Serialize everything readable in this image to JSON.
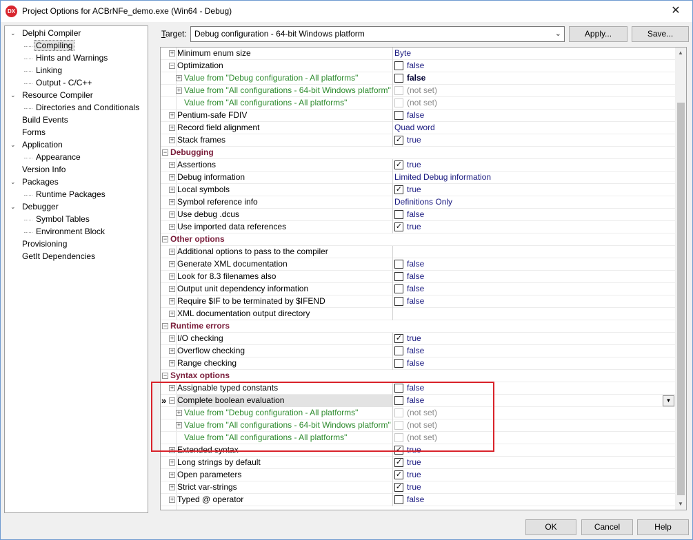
{
  "window": {
    "icon_text": "DX",
    "title": "Project Options for ACBrNFe_demo.exe  (Win64 - Debug)",
    "close_glyph": "✕"
  },
  "tree": [
    {
      "label": "Delphi Compiler",
      "level": 0,
      "expander": "⌄"
    },
    {
      "label": "Compiling",
      "level": 1,
      "selected": true
    },
    {
      "label": "Hints and Warnings",
      "level": 1
    },
    {
      "label": "Linking",
      "level": 1
    },
    {
      "label": "Output - C/C++",
      "level": 1
    },
    {
      "label": "Resource Compiler",
      "level": 0,
      "expander": "⌄"
    },
    {
      "label": "Directories and Conditionals",
      "level": 1
    },
    {
      "label": "Build Events",
      "level": 0
    },
    {
      "label": "Forms",
      "level": 0
    },
    {
      "label": "Application",
      "level": 0,
      "expander": "⌄"
    },
    {
      "label": "Appearance",
      "level": 1
    },
    {
      "label": "Version Info",
      "level": 0
    },
    {
      "label": "Packages",
      "level": 0,
      "expander": "⌄"
    },
    {
      "label": "Runtime Packages",
      "level": 1
    },
    {
      "label": "Debugger",
      "level": 0,
      "expander": "⌄"
    },
    {
      "label": "Symbol Tables",
      "level": 1
    },
    {
      "label": "Environment Block",
      "level": 1
    },
    {
      "label": "Provisioning",
      "level": 0
    },
    {
      "label": "GetIt Dependencies",
      "level": 0
    }
  ],
  "target": {
    "label_prefix": "T",
    "label_rest": "arget:",
    "value": "Debug configuration - 64-bit Windows platform",
    "arrow": "⌄",
    "apply": "Apply...",
    "save": "Save..."
  },
  "grid": [
    {
      "type": "item",
      "name": "Minimum enum size",
      "value": "Byte",
      "exp": "+"
    },
    {
      "type": "item",
      "name": "Optimization",
      "value": "false",
      "check": false,
      "exp": "−"
    },
    {
      "type": "sub",
      "name": "Value from \"Debug configuration - All platforms\"",
      "value": "false",
      "check": false,
      "bold": true,
      "exp": "+"
    },
    {
      "type": "sub",
      "name": "Value from \"All configurations - 64-bit Windows platform\"",
      "value": "(not set)",
      "check": false,
      "notset": true,
      "exp": "+"
    },
    {
      "type": "sub",
      "name": "Value from \"All configurations - All platforms\"",
      "value": "(not set)",
      "check": false,
      "notset": true
    },
    {
      "type": "item",
      "name": "Pentium-safe FDIV",
      "value": "false",
      "check": false,
      "exp": "+"
    },
    {
      "type": "item",
      "name": "Record field alignment",
      "value": "Quad word",
      "exp": "+"
    },
    {
      "type": "item",
      "name": "Stack frames",
      "value": "true",
      "check": true,
      "exp": "+"
    },
    {
      "type": "cat",
      "name": "Debugging"
    },
    {
      "type": "item",
      "name": "Assertions",
      "value": "true",
      "check": true,
      "exp": "+"
    },
    {
      "type": "item",
      "name": "Debug information",
      "value": "Limited Debug information",
      "exp": "+"
    },
    {
      "type": "item",
      "name": "Local symbols",
      "value": "true",
      "check": true,
      "exp": "+"
    },
    {
      "type": "item",
      "name": "Symbol reference info",
      "value": "Definitions Only",
      "exp": "+"
    },
    {
      "type": "item",
      "name": "Use debug .dcus",
      "value": "false",
      "check": false,
      "exp": "+"
    },
    {
      "type": "item",
      "name": "Use imported data references",
      "value": "true",
      "check": true,
      "exp": "+"
    },
    {
      "type": "cat",
      "name": "Other options"
    },
    {
      "type": "item",
      "name": "Additional options to pass to the compiler",
      "value": "",
      "exp": "+"
    },
    {
      "type": "item",
      "name": "Generate XML documentation",
      "value": "false",
      "check": false,
      "exp": "+"
    },
    {
      "type": "item",
      "name": "Look for 8.3 filenames also",
      "value": "false",
      "check": false,
      "exp": "+"
    },
    {
      "type": "item",
      "name": "Output unit dependency information",
      "value": "false",
      "check": false,
      "exp": "+"
    },
    {
      "type": "item",
      "name": "Require $IF to be terminated by $IFEND",
      "value": "false",
      "check": false,
      "exp": "+"
    },
    {
      "type": "item",
      "name": "XML documentation output directory",
      "value": "",
      "exp": "+"
    },
    {
      "type": "cat",
      "name": "Runtime errors"
    },
    {
      "type": "item",
      "name": "I/O checking",
      "value": "true",
      "check": true,
      "exp": "+"
    },
    {
      "type": "item",
      "name": "Overflow checking",
      "value": "false",
      "check": false,
      "exp": "+"
    },
    {
      "type": "item",
      "name": "Range checking",
      "value": "false",
      "check": false,
      "exp": "+"
    },
    {
      "type": "cat",
      "name": "Syntax options"
    },
    {
      "type": "item",
      "name": "Assignable typed constants",
      "value": "false",
      "check": false,
      "exp": "+"
    },
    {
      "type": "item",
      "name": "Complete boolean evaluation",
      "value": "false",
      "check": false,
      "exp": "−",
      "active": true,
      "marker": "»",
      "dropdown": "▼"
    },
    {
      "type": "sub",
      "name": "Value from \"Debug configuration - All platforms\"",
      "value": "(not set)",
      "check": false,
      "notset": true,
      "exp": "+"
    },
    {
      "type": "sub",
      "name": "Value from \"All configurations - 64-bit Windows platform\"",
      "value": "(not set)",
      "check": false,
      "notset": true,
      "exp": "+"
    },
    {
      "type": "sub",
      "name": "Value from \"All configurations - All platforms\"",
      "value": "(not set)",
      "check": false,
      "notset": true
    },
    {
      "type": "item",
      "name": "Extended syntax",
      "value": "true",
      "check": true,
      "exp": "+"
    },
    {
      "type": "item",
      "name": "Long strings by default",
      "value": "true",
      "check": true,
      "exp": "+"
    },
    {
      "type": "item",
      "name": "Open parameters",
      "value": "true",
      "check": true,
      "exp": "+"
    },
    {
      "type": "item",
      "name": "Strict var-strings",
      "value": "true",
      "check": true,
      "exp": "+"
    },
    {
      "type": "item",
      "name": "Typed @ operator",
      "value": "false",
      "check": false,
      "exp": "+"
    }
  ],
  "scroll": {
    "up": "▲",
    "down": "▼"
  },
  "buttons": {
    "ok": "OK",
    "cancel": "Cancel",
    "help": "Help"
  },
  "colors": {
    "category": "#7a1d3a",
    "inherited": "#2e8b2e",
    "value": "#1a1a80",
    "highlight_box": "#d9222a"
  }
}
